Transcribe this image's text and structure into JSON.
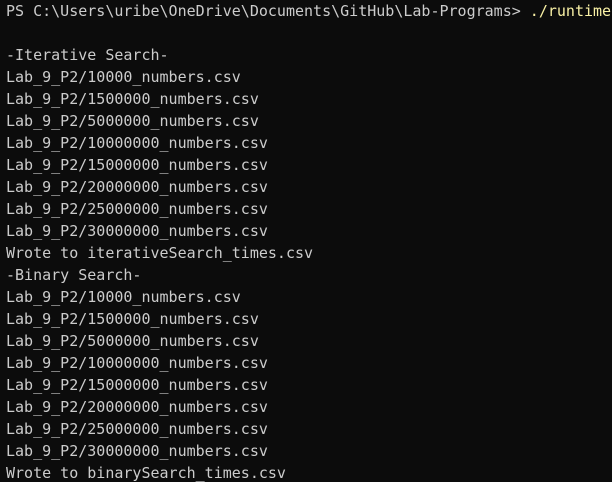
{
  "terminal": {
    "prompt": "PS C:\\Users\\uribe\\OneDrive\\Documents\\GitHub\\Lab-Programs>",
    "command": "./runtime",
    "lines": [
      "-Iterative Search-",
      "Lab_9_P2/10000_numbers.csv",
      "Lab_9_P2/1500000_numbers.csv",
      "Lab_9_P2/5000000_numbers.csv",
      "Lab_9_P2/10000000_numbers.csv",
      "Lab_9_P2/15000000_numbers.csv",
      "Lab_9_P2/20000000_numbers.csv",
      "Lab_9_P2/25000000_numbers.csv",
      "Lab_9_P2/30000000_numbers.csv",
      "Wrote to iterativeSearch_times.csv",
      "-Binary Search-",
      "Lab_9_P2/10000_numbers.csv",
      "Lab_9_P2/1500000_numbers.csv",
      "Lab_9_P2/5000000_numbers.csv",
      "Lab_9_P2/10000000_numbers.csv",
      "Lab_9_P2/15000000_numbers.csv",
      "Lab_9_P2/20000000_numbers.csv",
      "Lab_9_P2/25000000_numbers.csv",
      "Lab_9_P2/30000000_numbers.csv",
      "Wrote to binarySearch_times.csv"
    ]
  },
  "colors": {
    "background": "#0c0c0c",
    "text": "#cccccc",
    "command": "#f9f1a5"
  }
}
